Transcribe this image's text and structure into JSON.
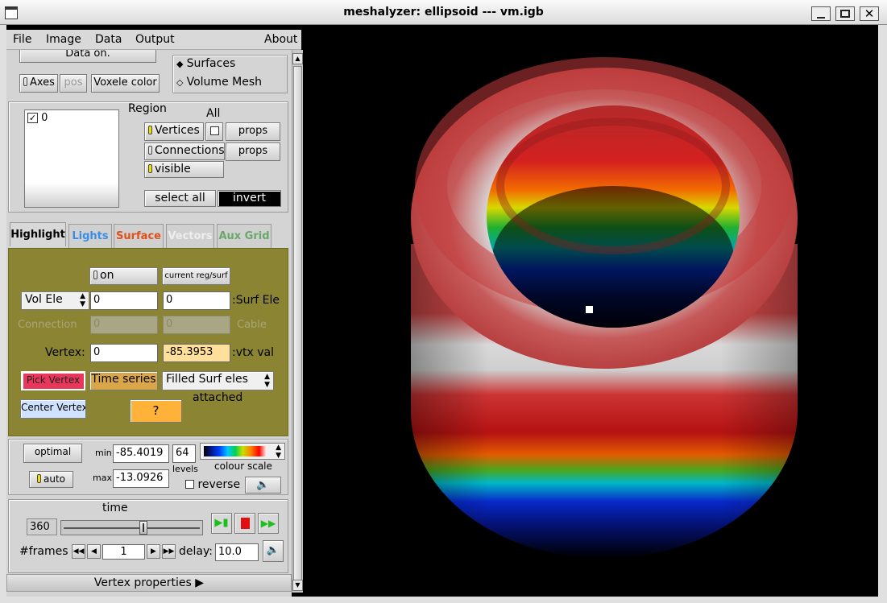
{
  "window": {
    "title": "meshalyzer: ellipsoid --- vm.igb"
  },
  "menu": {
    "file": "File",
    "image": "Image",
    "data": "Data",
    "output": "Output",
    "about": "About"
  },
  "top": {
    "data_on": "Data on.",
    "axes": "Axes",
    "pos": "pos",
    "voxele_color": "Voxele  color",
    "surfaces": "Surfaces",
    "volume_mesh": "Volume Mesh"
  },
  "region": {
    "title": "Region",
    "all": "All",
    "list": [
      "0"
    ],
    "vertices": "Vertices",
    "connections": "Connections",
    "visible": "visible",
    "props1": "props",
    "props2": "props",
    "select_all": "select all",
    "invert": "invert"
  },
  "tabs": {
    "highlight": "Highlight",
    "lights": "Lights",
    "surface": "Surface",
    "vectors": "Vectors",
    "aux_grid": "Aux Grid"
  },
  "highlight": {
    "on": "on",
    "current": "current reg/surf",
    "vol_ele": "Vol Ele",
    "vol_ele_val": "0",
    "surf_ele_val": "0",
    "surf_ele": ":Surf Ele",
    "connection": "Connection",
    "connection_val": "0",
    "cable_val": "0",
    "cable": "Cable",
    "vertex_label": "Vertex:",
    "vertex_val": "0",
    "vtx_val": "-85.3953",
    "vtx_val_label": ":vtx val",
    "pick_vertex": "Pick Vertex",
    "time_series": "Time series",
    "filled": "Filled Surf eles",
    "attached": "attached",
    "center_vertex": "Center Vertex",
    "help": "?"
  },
  "colour": {
    "optimal": "optimal",
    "auto": "auto",
    "min_label": "min",
    "min": "-85.4019",
    "max_label": "max",
    "max": "-13.0926",
    "levels": "64",
    "levels_label": "levels",
    "scale_label": "colour scale",
    "reverse": "reverse"
  },
  "time": {
    "label": "time",
    "value": "360",
    "slider_fraction": 0.59,
    "frames_label": "#frames",
    "frames": "1",
    "delay_label": "delay:",
    "delay": "10.0"
  },
  "footer": {
    "vertex_properties": "Vertex properties"
  }
}
